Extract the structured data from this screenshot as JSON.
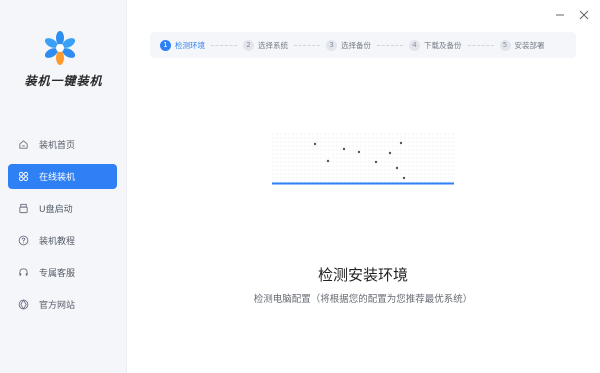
{
  "app": {
    "brand": "装机一键装机"
  },
  "sidebar": {
    "items": [
      {
        "label": "装机首页",
        "icon": "home-icon"
      },
      {
        "label": "在线装机",
        "icon": "online-install-icon"
      },
      {
        "label": "U盘启动",
        "icon": "usb-icon"
      },
      {
        "label": "装机教程",
        "icon": "help-icon"
      },
      {
        "label": "专属客服",
        "icon": "headset-icon"
      },
      {
        "label": "官方网站",
        "icon": "globe-icon"
      }
    ],
    "active_index": 1
  },
  "steps": [
    {
      "num": "1",
      "label": "检测环境"
    },
    {
      "num": "2",
      "label": "选择系统"
    },
    {
      "num": "3",
      "label": "选择备份"
    },
    {
      "num": "4",
      "label": "下载及备份"
    },
    {
      "num": "5",
      "label": "安装部署"
    }
  ],
  "main": {
    "title": "检测安装环境",
    "subtitle": "检测电脑配置（将根据您的配置为您推荐最优系统）"
  },
  "colors": {
    "accent": "#2f7ff5",
    "sidebar_bg": "#f4f6fa"
  }
}
